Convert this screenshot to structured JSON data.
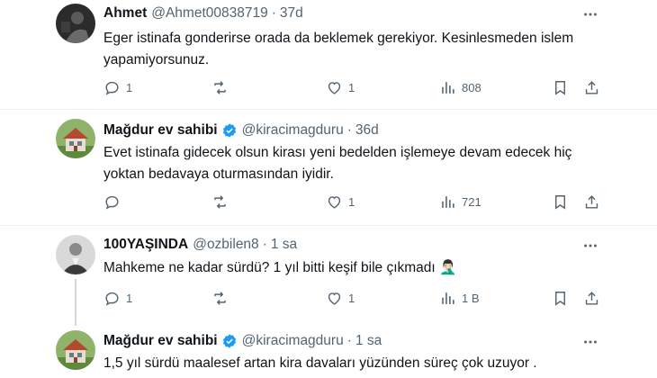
{
  "tweets": [
    {
      "name": "Ahmet",
      "handle": "@Ahmet00838719",
      "time": "37d",
      "verified": false,
      "text": "Eger istinafa gonderirse orada da beklemek gerekiyor. Kesinlesmeden islem yapamiyorsunuz.",
      "replies": "1",
      "retweets": "",
      "likes": "1",
      "views": "808"
    },
    {
      "name": "Mağdur ev sahibi",
      "handle": "@kiracimagduru",
      "time": "36d",
      "verified": true,
      "text": "Evet istinafa gidecek olsun kirası yeni bedelden işlemeye devam edecek hiç yoktan bedavaya oturmasından iyidir.",
      "replies": "",
      "retweets": "",
      "likes": "1",
      "views": "721"
    },
    {
      "name": "100YAŞINDA",
      "handle": "@ozbilen8",
      "time": "1 sa",
      "verified": false,
      "text": "Mahkeme ne kadar sürdü? 1 yıl bitti keşif bile çıkmadı 🤦🏻‍♂️",
      "replies": "1",
      "retweets": "",
      "likes": "1",
      "views": "1 B"
    },
    {
      "name": "Mağdur ev sahibi",
      "handle": "@kiracimagduru",
      "time": "1 sa",
      "verified": true,
      "text": "1,5 yıl sürdü maalesef artan kira davaları yüzünden süreç çok uzuyor .",
      "replies": "",
      "retweets": "",
      "likes": "",
      "views": ""
    }
  ],
  "separator": "·",
  "colors": {
    "text": "#0f1419",
    "secondary": "#536471",
    "verified": "#1d9bf0",
    "divider": "#eff3f4"
  },
  "icons": [
    "reply-icon",
    "retweet-icon",
    "like-icon",
    "views-icon",
    "bookmark-icon",
    "share-icon",
    "more-icon",
    "verified-badge-icon"
  ]
}
